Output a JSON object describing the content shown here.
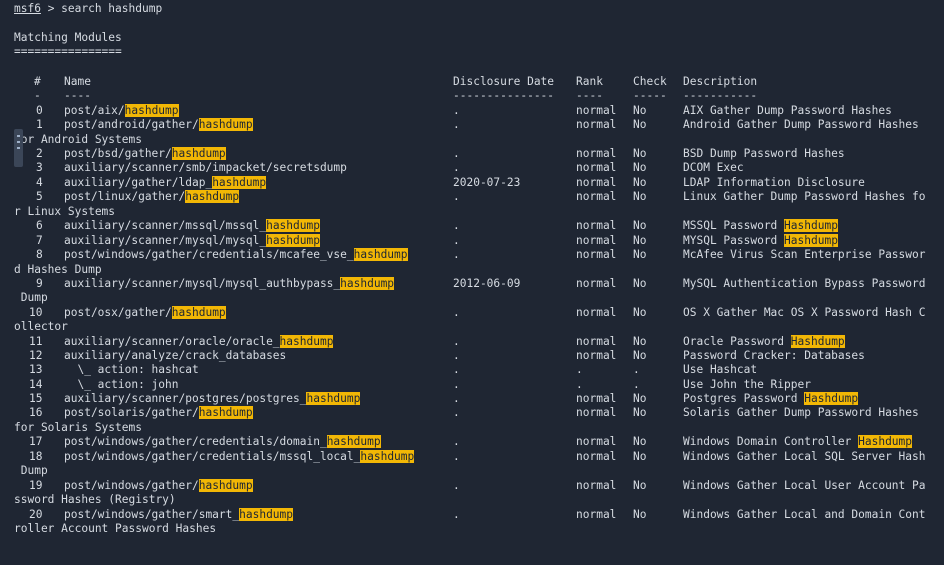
{
  "prompt": {
    "name": "msf6",
    "command": " > search hashdump"
  },
  "heading": "Matching Modules",
  "heading_rule": "================",
  "columns": {
    "num": "#",
    "name": "Name",
    "date": "Disclosure Date",
    "rank": "Rank",
    "check": "Check",
    "desc": "Description"
  },
  "column_rules": {
    "num": "-",
    "name": "----",
    "date": "---------------",
    "rank": "----",
    "check": "-----",
    "desc": "-----------"
  },
  "rows": [
    {
      "num": "0",
      "pre": "post/aix/",
      "hl": "hashdump",
      "post": "",
      "date": ".",
      "rank": "normal",
      "check": "No",
      "desc": "AIX Gather Dump Password Hashes",
      "wrap": ""
    },
    {
      "num": "1",
      "pre": "post/android/gather/",
      "hl": "hashdump",
      "post": "",
      "date": ".",
      "rank": "normal",
      "check": "No",
      "desc": "Android Gather Dump Password Hashes",
      "wrap": "for Android Systems"
    },
    {
      "num": "2",
      "pre": "post/bsd/gather/",
      "hl": "hashdump",
      "post": "",
      "date": ".",
      "rank": "normal",
      "check": "No",
      "desc": "BSD Dump Password Hashes",
      "wrap": ""
    },
    {
      "num": "3",
      "pre": "auxiliary/scanner/smb/impacket/secretsdump",
      "hl": "",
      "post": "",
      "date": ".",
      "rank": "normal",
      "check": "No",
      "desc": "DCOM Exec",
      "wrap": ""
    },
    {
      "num": "4",
      "pre": "auxiliary/gather/ldap_",
      "hl": "hashdump",
      "post": "",
      "date": "2020-07-23",
      "rank": "normal",
      "check": "No",
      "desc": "LDAP Information Disclosure",
      "wrap": ""
    },
    {
      "num": "5",
      "pre": "post/linux/gather/",
      "hl": "hashdump",
      "post": "",
      "date": ".",
      "rank": "normal",
      "check": "No",
      "desc": "Linux Gather Dump Password Hashes fo",
      "wrap": "r Linux Systems"
    },
    {
      "num": "6",
      "pre": "auxiliary/scanner/mssql/mssql_",
      "hl": "hashdump",
      "post": "",
      "date": ".",
      "rank": "normal",
      "check": "No",
      "desc": "MSSQL Password ",
      "deschl": "Hashdump",
      "wrap": ""
    },
    {
      "num": "7",
      "pre": "auxiliary/scanner/mysql/mysql_",
      "hl": "hashdump",
      "post": "",
      "date": ".",
      "rank": "normal",
      "check": "No",
      "desc": "MYSQL Password ",
      "deschl": "Hashdump",
      "wrap": ""
    },
    {
      "num": "8",
      "pre": "post/windows/gather/credentials/mcafee_vse_",
      "hl": "hashdump",
      "post": "",
      "date": ".",
      "rank": "normal",
      "check": "No",
      "desc": "McAfee Virus Scan Enterprise Passwor",
      "wrap": "d Hashes Dump"
    },
    {
      "num": "9",
      "pre": "auxiliary/scanner/mysql/mysql_authbypass_",
      "hl": "hashdump",
      "post": "",
      "date": "2012-06-09",
      "rank": "normal",
      "check": "No",
      "desc": "MySQL Authentication Bypass Password",
      "wrap": " Dump"
    },
    {
      "num": "10",
      "pre": "post/osx/gather/",
      "hl": "hashdump",
      "post": "",
      "date": ".",
      "rank": "normal",
      "check": "No",
      "desc": "OS X Gather Mac OS X Password Hash C",
      "wrap": "ollector"
    },
    {
      "num": "11",
      "pre": "auxiliary/scanner/oracle/oracle_",
      "hl": "hashdump",
      "post": "",
      "date": ".",
      "rank": "normal",
      "check": "No",
      "desc": "Oracle Password ",
      "deschl": "Hashdump",
      "wrap": ""
    },
    {
      "num": "12",
      "pre": "auxiliary/analyze/crack_databases",
      "hl": "",
      "post": "",
      "date": ".",
      "rank": "normal",
      "check": "No",
      "desc": "Password Cracker: Databases",
      "wrap": ""
    },
    {
      "num": "13",
      "pre": "  \\_ action: hashcat",
      "hl": "",
      "post": "",
      "date": ".",
      "rank": ".",
      "check": ".",
      "desc": "Use Hashcat",
      "wrap": ""
    },
    {
      "num": "14",
      "pre": "  \\_ action: john",
      "hl": "",
      "post": "",
      "date": ".",
      "rank": ".",
      "check": ".",
      "desc": "Use John the Ripper",
      "wrap": ""
    },
    {
      "num": "15",
      "pre": "auxiliary/scanner/postgres/postgres_",
      "hl": "hashdump",
      "post": "",
      "date": ".",
      "rank": "normal",
      "check": "No",
      "desc": "Postgres Password ",
      "deschl": "Hashdump",
      "wrap": ""
    },
    {
      "num": "16",
      "pre": "post/solaris/gather/",
      "hl": "hashdump",
      "post": "",
      "date": ".",
      "rank": "normal",
      "check": "No",
      "desc": "Solaris Gather Dump Password Hashes",
      "wrap": "for Solaris Systems"
    },
    {
      "num": "17",
      "pre": "post/windows/gather/credentials/domain_",
      "hl": "hashdump",
      "post": "",
      "date": ".",
      "rank": "normal",
      "check": "No",
      "desc": "Windows Domain Controller ",
      "deschl": "Hashdump",
      "wrap": ""
    },
    {
      "num": "18",
      "pre": "post/windows/gather/credentials/mssql_local_",
      "hl": "hashdump",
      "post": "",
      "date": ".",
      "rank": "normal",
      "check": "No",
      "desc": "Windows Gather Local SQL Server Hash",
      "wrap": " Dump"
    },
    {
      "num": "19",
      "pre": "post/windows/gather/",
      "hl": "hashdump",
      "post": "",
      "date": ".",
      "rank": "normal",
      "check": "No",
      "desc": "Windows Gather Local User Account Pa",
      "wrap": "ssword Hashes (Registry)"
    },
    {
      "num": "20",
      "pre": "post/windows/gather/smart_",
      "hl": "hashdump",
      "post": "",
      "date": ".",
      "rank": "normal",
      "check": "No",
      "desc": "Windows Gather Local and Domain Cont",
      "wrap": "roller Account Password Hashes"
    }
  ],
  "colors": {
    "background": "#1f2633",
    "text": "#d6dbe2",
    "highlight": "#f2b705"
  }
}
